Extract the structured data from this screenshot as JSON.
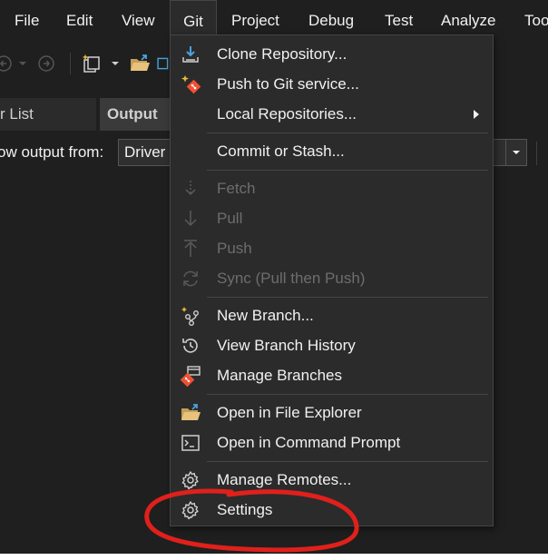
{
  "menubar": {
    "items": [
      {
        "label": "File"
      },
      {
        "label": "Edit"
      },
      {
        "label": "View"
      },
      {
        "label": "Git"
      },
      {
        "label": "Project"
      },
      {
        "label": "Debug"
      },
      {
        "label": "Test"
      },
      {
        "label": "Analyze"
      },
      {
        "label": "Too"
      }
    ]
  },
  "tabs": {
    "left": "r List",
    "active": "Output"
  },
  "output": {
    "label": "ow output from:",
    "source": "Driver"
  },
  "git_menu": {
    "items": [
      {
        "label": "Clone Repository...",
        "icon": "clone-icon"
      },
      {
        "label": "Push to Git service...",
        "icon": "git-push-service-icon"
      },
      {
        "label": "Local Repositories...",
        "icon": "",
        "submenu": true
      },
      {
        "label": "Commit or Stash...",
        "icon": ""
      },
      {
        "label": "Fetch",
        "icon": "fetch-icon",
        "disabled": true
      },
      {
        "label": "Pull",
        "icon": "pull-icon",
        "disabled": true
      },
      {
        "label": "Push",
        "icon": "push-icon",
        "disabled": true
      },
      {
        "label": "Sync (Pull then Push)",
        "icon": "sync-icon",
        "disabled": true
      },
      {
        "label": "New Branch...",
        "icon": "new-branch-icon"
      },
      {
        "label": "View Branch History",
        "icon": "history-icon"
      },
      {
        "label": "Manage Branches",
        "icon": "manage-branches-icon"
      },
      {
        "label": "Open in File Explorer",
        "icon": "folder-open-icon"
      },
      {
        "label": "Open in Command Prompt",
        "icon": "terminal-icon"
      },
      {
        "label": "Manage Remotes...",
        "icon": "gear-icon"
      },
      {
        "label": "Settings",
        "icon": "gear-icon"
      }
    ]
  },
  "colors": {
    "background": "#1f1f1f",
    "menu_bg": "#2b2b2b",
    "text": "#f1f1f1",
    "disabled_text": "#6d6d6d",
    "git_orange": "#f05033",
    "folder_yellow": "#dcb67a",
    "annotation_red": "#e0201b"
  }
}
